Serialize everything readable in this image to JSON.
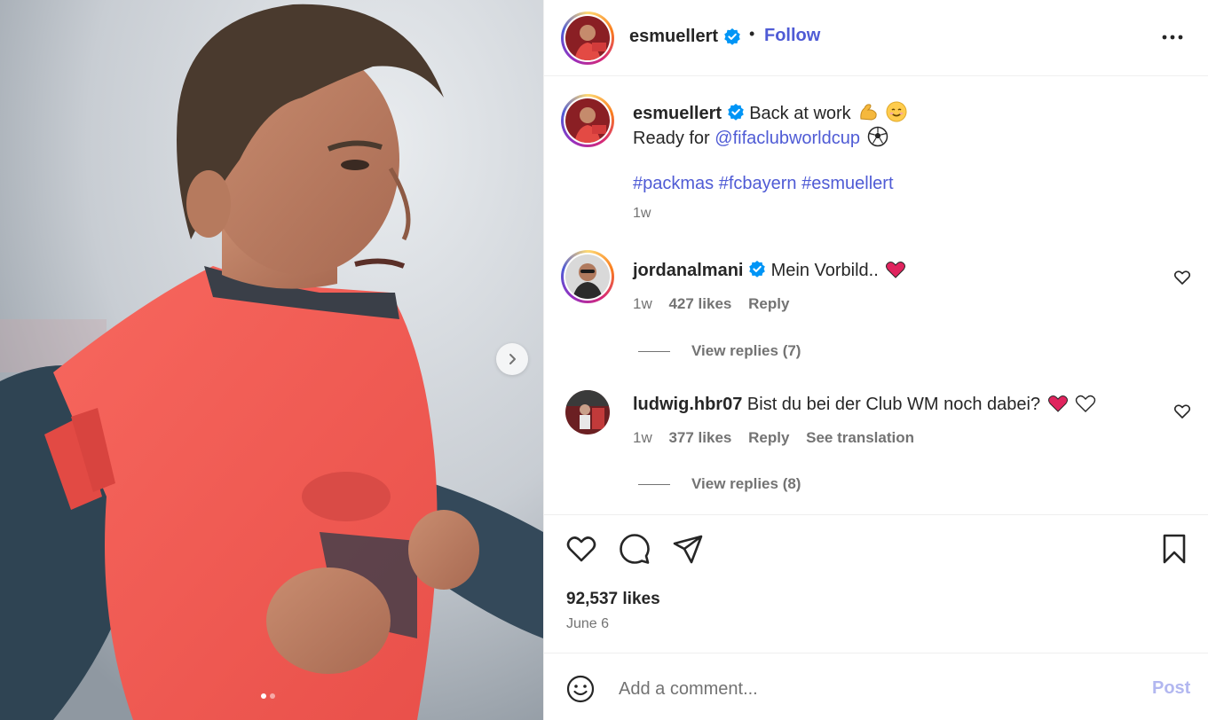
{
  "colors": {
    "accent": "#4f5bd5",
    "text": "#262626",
    "muted": "#737373",
    "post_disabled": "#b2b7f0",
    "jacket": "#f25c54",
    "navy": "#2f4453"
  },
  "media": {
    "carousel_next_icon": "chevron-right-icon",
    "slide_count": 2,
    "active_slide": 1
  },
  "header": {
    "username": "esmuellert",
    "bullet": "•",
    "follow_label": "Follow",
    "more_icon": "more-options-icon"
  },
  "caption": {
    "username": "esmuellert",
    "text1": "Back at work",
    "line2_prefix": "Ready for",
    "mention": "@fifaclubworldcup",
    "hashtags": [
      "#packmas",
      "#fcbayern",
      "#esmuellert"
    ],
    "time": "1w"
  },
  "comments": [
    {
      "username": "jordanalmani",
      "verified": true,
      "text": "Mein Vorbild..",
      "time": "1w",
      "likes": "427 likes",
      "reply": "Reply",
      "view_replies": "View replies (7)"
    },
    {
      "username": "ludwig.hbr07",
      "verified": false,
      "text": "Bist du bei der Club WM noch dabei?",
      "time": "1w",
      "likes": "377 likes",
      "reply": "Reply",
      "translate": "See translation",
      "view_replies": "View replies (8)"
    }
  ],
  "actions": {
    "likes_total": "92,537 likes",
    "date": "June 6"
  },
  "composer": {
    "placeholder": "Add a comment...",
    "post_label": "Post"
  }
}
